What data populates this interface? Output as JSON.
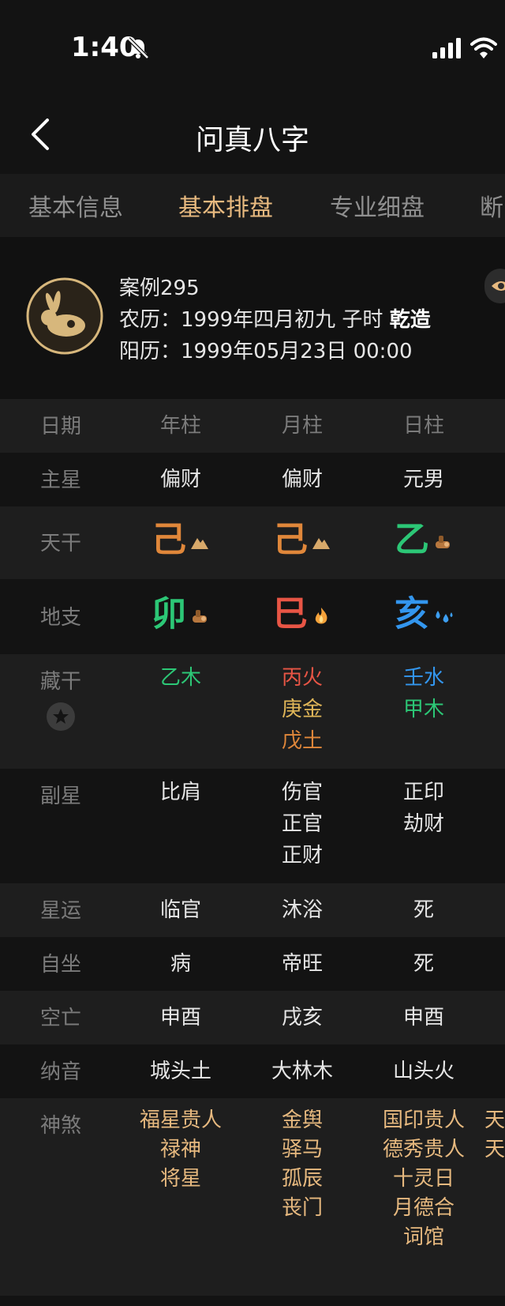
{
  "status": {
    "time": "1:40"
  },
  "nav": {
    "title": "问真八字"
  },
  "tabs": [
    {
      "label": "基本信息"
    },
    {
      "label": "基本排盘"
    },
    {
      "label": "专业细盘"
    },
    {
      "label": "断"
    }
  ],
  "profile": {
    "name": "案例295",
    "lunar_prefix": "农历：1999年四月初九 子时",
    "lunar_gender": "乾造",
    "solar": "阳历：1999年05月23日 00:00"
  },
  "columns": [
    "日期",
    "年柱",
    "月柱",
    "日柱"
  ],
  "rows": {
    "main_star": {
      "label": "主星",
      "values": [
        "偏财",
        "偏财",
        "元男"
      ]
    },
    "tiangan": {
      "label": "天干",
      "chars": [
        "己",
        "己",
        "乙"
      ],
      "colors": [
        "#e0873a",
        "#e0873a",
        "#2cc776"
      ],
      "icons": [
        "earth-icon",
        "earth-icon",
        "wood-icon"
      ]
    },
    "dizhi": {
      "label": "地支",
      "chars": [
        "卯",
        "巳",
        "亥"
      ],
      "colors": [
        "#2cc776",
        "#e85545",
        "#3396ee"
      ],
      "icons": [
        "wood-icon",
        "fire-icon",
        "water-icon"
      ]
    },
    "canggan": {
      "label": "藏干",
      "cols": [
        [
          {
            "t": "乙木",
            "c": "#2cc776"
          }
        ],
        [
          {
            "t": "丙火",
            "c": "#e85545"
          },
          {
            "t": "庚金",
            "c": "#e0b658"
          },
          {
            "t": "戊土",
            "c": "#e0873a"
          }
        ],
        [
          {
            "t": "壬水",
            "c": "#3396ee"
          },
          {
            "t": "甲木",
            "c": "#2cc776"
          }
        ]
      ]
    },
    "fuxing": {
      "label": "副星",
      "cols": [
        [
          "比肩"
        ],
        [
          "伤官",
          "正官",
          "正财"
        ],
        [
          "正印",
          "劫财"
        ]
      ]
    },
    "xingyun": {
      "label": "星运",
      "values": [
        "临官",
        "沐浴",
        "死"
      ]
    },
    "zizuo": {
      "label": "自坐",
      "values": [
        "病",
        "帝旺",
        "死"
      ]
    },
    "kongwang": {
      "label": "空亡",
      "values": [
        "申酉",
        "戌亥",
        "申酉"
      ]
    },
    "nayin": {
      "label": "纳音",
      "values": [
        "城头土",
        "大林木",
        "山头火"
      ]
    },
    "shensha": {
      "label": "神煞",
      "cols": [
        [
          "福星贵人",
          "禄神",
          "将星"
        ],
        [
          "金舆",
          "驿马",
          "孤辰",
          "丧门"
        ],
        [
          "国印贵人",
          "德秀贵人",
          "十灵日",
          "月德合",
          "词馆"
        ]
      ],
      "partial": [
        "天",
        "天"
      ]
    }
  }
}
